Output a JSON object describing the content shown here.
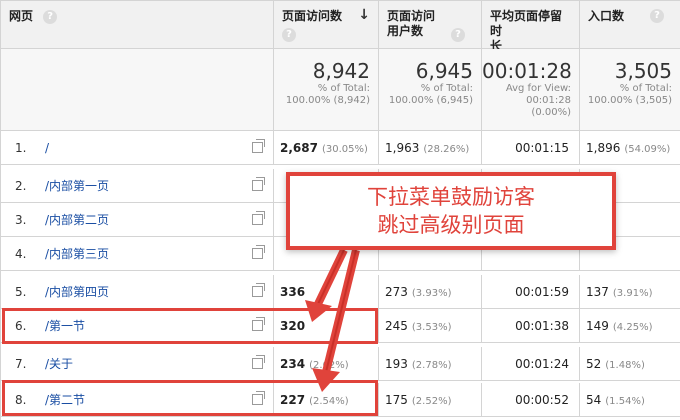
{
  "headers": {
    "page": "网页",
    "pageviews": "页面访问数",
    "unique_line1": "页面访问",
    "unique_line2": "用户数",
    "avg_line1": "平均页面停留时",
    "avg_line2": "长",
    "entrances": "入口数",
    "help_glyph": "?",
    "sort_glyph": "↓"
  },
  "totals": {
    "pageviews": {
      "value": "8,942",
      "l1": "% of Total:",
      "l2": "100.00% (8,942)"
    },
    "unique": {
      "value": "6,945",
      "l1": "% of Total:",
      "l2": "100.00% (6,945)"
    },
    "avg": {
      "value": "00:01:28",
      "l1": "Avg for View:",
      "l2": "00:01:28",
      "l3": "(0.00%)"
    },
    "entrances": {
      "value": "3,505",
      "l1": "% of Total:",
      "l2": "100.00% (3,505)"
    }
  },
  "rows": [
    {
      "idx": "1.",
      "path": "/",
      "pv": "2,687",
      "pv_pct": "(30.05%)",
      "uv": "1,963",
      "uv_pct": "(28.26%)",
      "avg": "00:01:15",
      "ent": "1,896",
      "ent_pct": "(54.09%)"
    },
    {
      "idx": "2.",
      "path": "/内部第一页",
      "pv": "",
      "pv_pct": "",
      "uv": "",
      "uv_pct": "",
      "avg": "",
      "ent": "",
      "ent_pct": ""
    },
    {
      "idx": "3.",
      "path": "/内部第二页",
      "pv": "",
      "pv_pct": "",
      "uv": "",
      "uv_pct": "",
      "avg": "",
      "ent": "",
      "ent_pct": ""
    },
    {
      "idx": "4.",
      "path": "/内部第三页",
      "pv": "",
      "pv_pct": "",
      "uv": "",
      "uv_pct": "",
      "avg": "",
      "ent": "",
      "ent_pct": ""
    },
    {
      "idx": "5.",
      "path": "/内部第四页",
      "pv": "336",
      "pv_pct": "",
      "uv": "273",
      "uv_pct": "(3.93%)",
      "avg": "00:01:59",
      "ent": "137",
      "ent_pct": "(3.91%)"
    },
    {
      "idx": "6.",
      "path": "/第一节",
      "pv": "320",
      "pv_pct": "",
      "uv": "245",
      "uv_pct": "(3.53%)",
      "avg": "00:01:38",
      "ent": "149",
      "ent_pct": "(4.25%)"
    },
    {
      "idx": "7.",
      "path": "/关于",
      "pv": "234",
      "pv_pct": "(2.62%)",
      "uv": "193",
      "uv_pct": "(2.78%)",
      "avg": "00:01:24",
      "ent": "52",
      "ent_pct": "(1.48%)"
    },
    {
      "idx": "8.",
      "path": "/第二节",
      "pv": "227",
      "pv_pct": "(2.54%)",
      "uv": "175",
      "uv_pct": "(2.52%)",
      "avg": "00:00:52",
      "ent": "54",
      "ent_pct": "(1.54%)"
    }
  ],
  "callout": {
    "line1": "下拉菜单鼓励访客",
    "line2": "跳过高级别页面"
  },
  "colors": {
    "accent": "#e0433b",
    "link": "#1a4ea3"
  }
}
